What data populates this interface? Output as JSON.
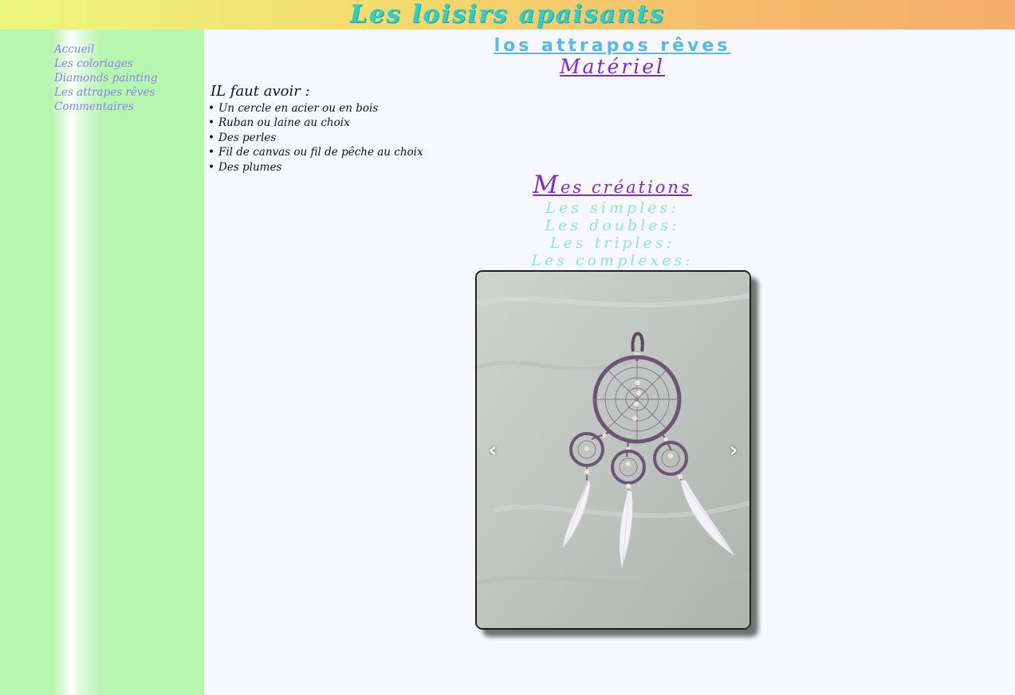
{
  "header": {
    "site_title": "Les loisirs apaisants"
  },
  "sidebar": {
    "items": [
      {
        "label": "Accueil"
      },
      {
        "label": "Les coloriages"
      },
      {
        "label": "Diamonds painting"
      },
      {
        "label": "Les attrapes rêves"
      },
      {
        "label": "Commentaires"
      }
    ]
  },
  "main": {
    "page_heading": "los attrapos rêves",
    "materiel_heading": "Matériel",
    "needs_title": "IL faut avoir :",
    "supplies": [
      "Un cercle en acier ou en bois",
      "Ruban ou laine au choix",
      "Des perles",
      "Fil de canvas ou fil de pêche au choix",
      "Des plumes"
    ],
    "creations_heading_first": "M",
    "creations_heading_rest": "es créations",
    "categories": [
      "Les simples:",
      "Les doubles:",
      "Les triples:",
      "Les complexes:"
    ]
  },
  "slideshow": {
    "prev_symbol": "‹",
    "next_symbol": "›",
    "image_subject": "dreamcatcher-photo"
  },
  "colors": {
    "header_gradient_start": "#ecf77e",
    "header_gradient_end": "#f5ae6c",
    "site_title": "#2ecfc4",
    "sidebar_bg": "#b6f6b0",
    "nav_link": "#8a82e8",
    "page_heading": "#57b8ec",
    "section_heading": "#8226dd",
    "category_text": "#8de9c7",
    "page_bg": "#f7f8fd"
  }
}
